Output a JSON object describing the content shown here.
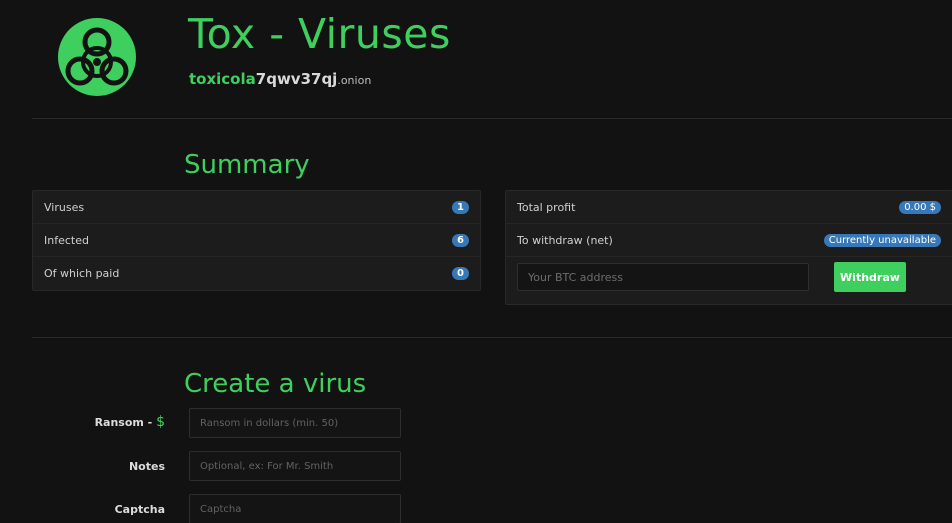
{
  "header": {
    "title": "Tox - Viruses",
    "onion_green": "toxicola",
    "onion_rest": "7qwv37qj",
    "onion_tld": ".onion",
    "logo_icon": "biohazard-icon"
  },
  "summary": {
    "heading": "Summary",
    "stats": [
      {
        "label": "Viruses",
        "value": "1"
      },
      {
        "label": "Infected",
        "value": "6"
      },
      {
        "label": "Of which paid",
        "value": "0"
      }
    ],
    "profit": {
      "total_label": "Total profit",
      "total_value": "0.00 $",
      "withdraw_label": "To withdraw (net)",
      "withdraw_value": "Currently unavailable",
      "btc_placeholder": "Your BTC address",
      "withdraw_button": "Withdraw"
    }
  },
  "create": {
    "heading": "Create a virus",
    "ransom_label": "Ransom - ",
    "ransom_currency": "$",
    "ransom_placeholder": "Ransom in dollars (min. 50)",
    "notes_label": "Notes",
    "notes_placeholder": "Optional, ex: For Mr. Smith",
    "captcha_label": "Captcha",
    "captcha_placeholder": "Captcha"
  },
  "colors": {
    "accent": "#3ecf5e",
    "badge": "#3779b8",
    "background": "#121212",
    "panel": "#1c1c1c"
  }
}
